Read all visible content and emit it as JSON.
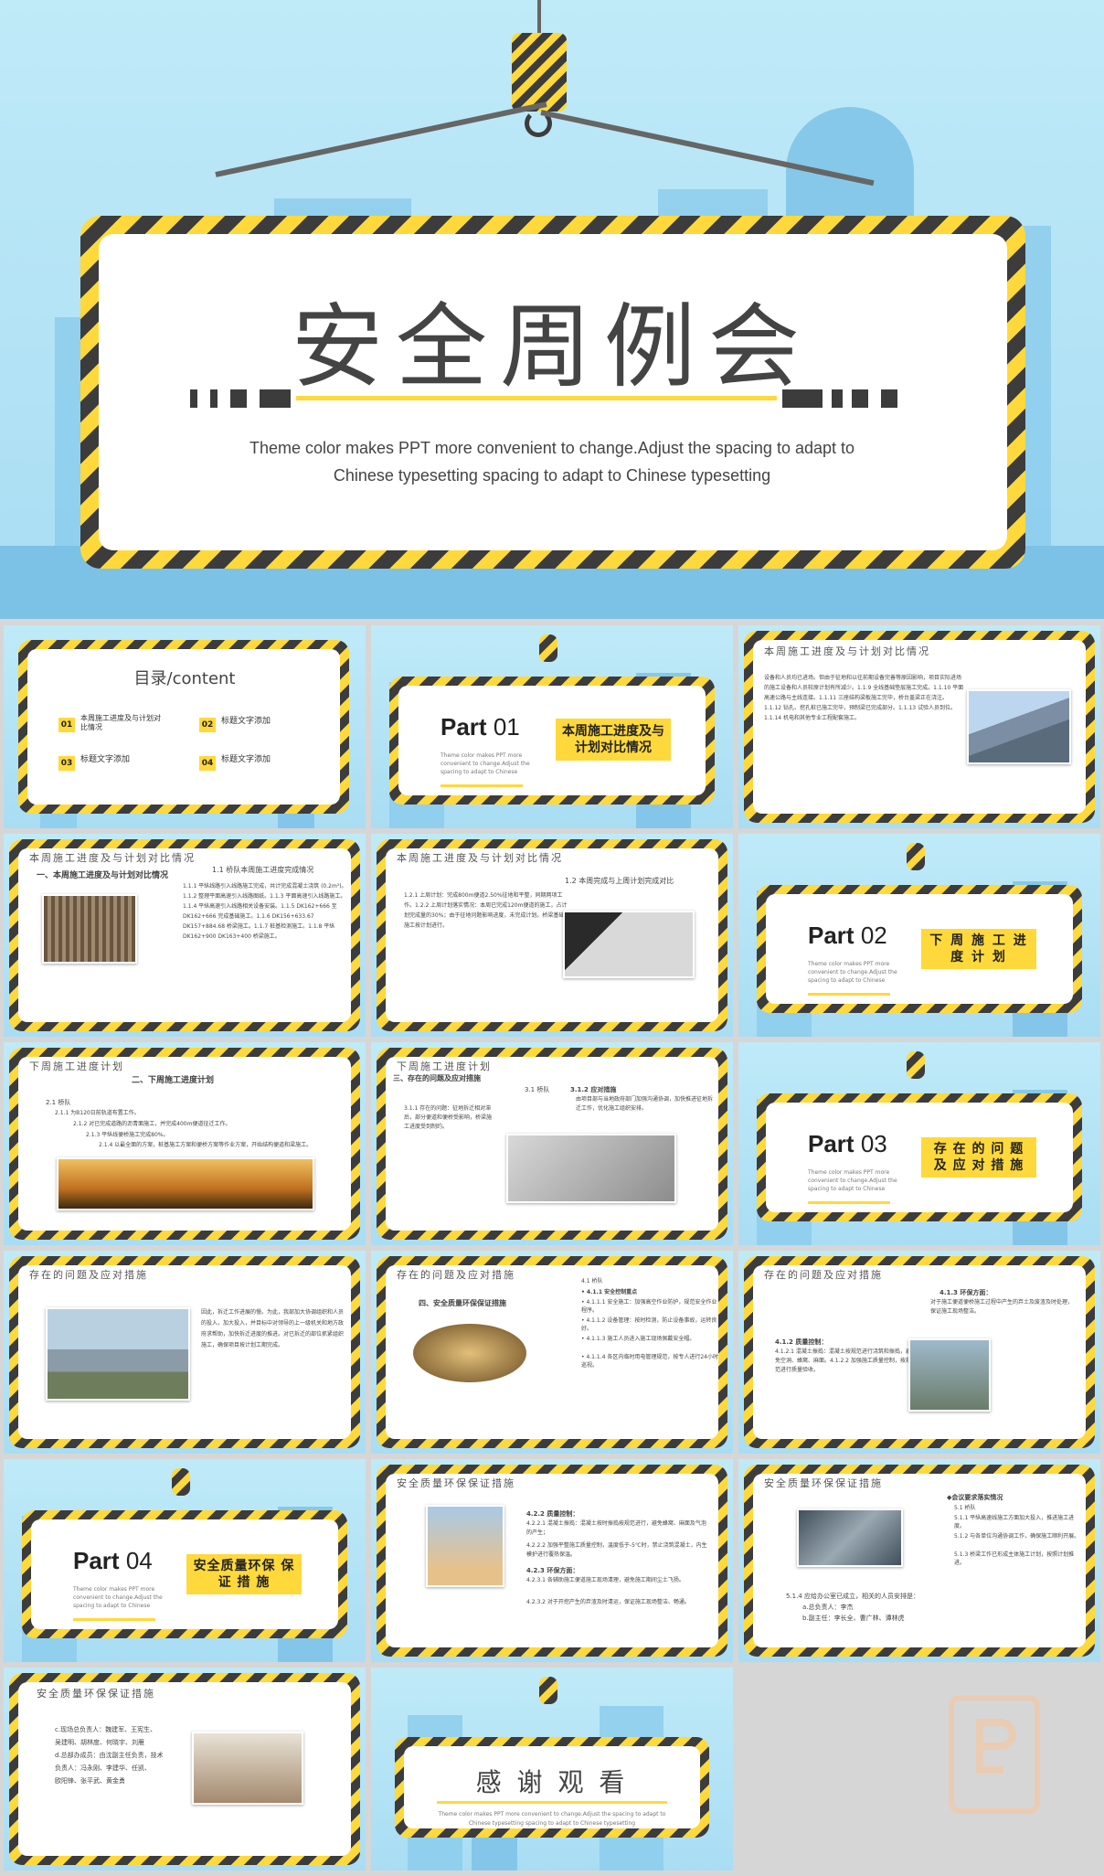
{
  "title_slide": {
    "title": "安全周例会",
    "subtitle_line1": "Theme color makes PPT more convenient to change.Adjust the spacing to adapt to",
    "subtitle_line2": "Chinese typesetting spacing to adapt to Chinese typesetting"
  },
  "toc": {
    "title": "目录/content",
    "items": [
      {
        "num": "01",
        "label": "本周施工进度及与计划对比情况"
      },
      {
        "num": "02",
        "label": "标题文字添加"
      },
      {
        "num": "03",
        "label": "标题文字添加"
      },
      {
        "num": "04",
        "label": "标题文字添加"
      }
    ]
  },
  "part_note": "Theme color makes PPT more convenient to change.Adjust the spacing to adapt to Chinese",
  "parts": [
    {
      "part": "Part",
      "num": "01",
      "title": "本周施工进度及与计划对比情况"
    },
    {
      "part": "Part",
      "num": "02",
      "title": "下 周 施 工 进 度 计 划"
    },
    {
      "part": "Part",
      "num": "03",
      "title": "存 在 的 问 题 及 应 对 措 施"
    },
    {
      "part": "Part",
      "num": "04",
      "title": "安全质量环保 保 证 措 施"
    }
  ],
  "section_titles": {
    "s1": "本周施工进度及与计划对比情况",
    "s2": "下周施工进度计划",
    "s3": "存在的问题及应对措施",
    "s4": "安全质量环保保证措施"
  },
  "slide3": {
    "body": "设备和人员均已进场。但由于征地和以往前期设备完善等原因影响，项目实际进场的施工设备和人员较原计划有所减少。1.1.9 全线基础垫层施工完成。1.1.10 平面高速公路与主线连接。1.1.11 三座结构梁板施工完毕，桥台盖梁正在浇注。1.1.12 钻孔、挖孔桩已施工完毕，预制梁已完成部分。1.1.13 试验人员到位。1.1.14 机电和其他专业工程配套施工。"
  },
  "slide4": {
    "heading": "一、本周施工进度及与计划对比情况",
    "sub": "1.1 桥队本周施工进度完成情况",
    "body": "1.1.1 平纵线路引入线路施工完成，共计完成混凝土浇筑 (0.2m³)。1.1.2 整理平面高速引入线路图纸。1.1.3 平面高速引入线路施工。1.1.4 平纵高速引入线路相关设备安装。1.1.5 DK162+666 至 DK162+666 完成基础施工。1.1.6 DK156+633.67 DK157+884.68 桥梁施工。1.1.7 桩基检测施工。1.1.8 平纵 DK162+900 DK163+400 桥梁施工。"
  },
  "slide5": {
    "sub": "1.2 本周完成与上周计划完成对比",
    "body": "1.2.1 上周计划：完成800m便道2.50%征地和平整，同期两项工作。1.2.2 上周计划落实情况：本周已完成120m便道的施工，占计划完成量的30%；由于征地问题影响进度，未完成计划。桥梁基础施工按计划进行。"
  },
  "slide7": {
    "heading": "二、下周施工进度计划",
    "body_lines": [
      "2.1 桥队",
      "2.1.1 为B120日前轨道布置工作。",
      "2.1.2 对已完成道路的沥青面施工，并完成400m便道征迁工作。",
      "2.1.3 平纵线便桥施工完成80%。",
      "2.1.4 以最全面的方案，桩基施工方案和便桥方案等作业方案，开始结构便道和梁施工。"
    ]
  },
  "slide8": {
    "heading": "三、存在的问题及应对措施",
    "sub_a": "3.1 桥队",
    "sub_b": "3.1.2 应对措施",
    "body_a": "3.1.1 存在的问题：征地拆迁相对滞后，部分便道和便桥受影响，桥梁施工进度受到制约。",
    "body_b": "由项目部与当地政府部门加强沟通协调，加快推进征地拆迁工作，优化施工组织安排。"
  },
  "slide10": {
    "body": "因此，拆迁工作进展的慢。为此，我部加大协调组织和人员的投入，加大投入，并目标中对领导的上一级机关和地方政府求帮助，加快拆迁进度的推进。对已拆迁的部位抓紧组织施工，确保项目按计划工期完成。"
  },
  "slide11": {
    "heading": "四、安全质量环保保证措施",
    "lines": [
      "4.1 桥队",
      "• 4.1.1 安全控制重点",
      "• 4.1.1.1 安全施工：加强高空作业防护，规范安全作业程序。",
      "• 4.1.1.2 设备管理：按时检测，防止设备事故，运转良好。",
      "• 4.1.1.3 施工人员进入施工现场佩戴安全帽。",
      "• 4.1.1.4 各区内临时用电管理规范，按专人进行24小时巡视。"
    ]
  },
  "slide12": {
    "a_title": "4.1.3 环保方面：",
    "a_body": "对于施工便道便桥施工过程中产生的弃土及废渣及时处理，保证施工现场整洁。",
    "b_title": "4.1.2 质量控制：",
    "b_body": "4.1.2.1 混凝土振捣：混凝土按规范进行浇筑和振捣，避免空洞、蜂窝、麻面。4.1.2.2 加强施工质量控制，按规范进行质量验收。"
  },
  "slide14": {
    "lines": [
      "4.2.2 质量控制：",
      "4.2.2.1 混凝土振捣：混凝土按时振捣按规范进行，避免蜂窝、麻面及气泡的产生；",
      "4.2.2.2 加强平整施工质量控制，温度低于-5℃时，禁止浇筑混凝土，内生模护进行覆热保温。",
      "4.2.3 环保方面：",
      "4.2.3.1 各辅助施工便道施工现场清理，避免施工期间尘土飞扬。",
      "4.2.3.2 对于开挖产生的弃渣及时清运，保证施工现场整洁、畅通。"
    ]
  },
  "slide15": {
    "head": "◆会议要求落实情况",
    "lines": [
      "5.1 桥队",
      "5.1.1 平纵高速线施工方面加大投入，推进施工进度。",
      "5.1.2 与各单位沟通协调工作，确保施工顺利开展。",
      "5.1.3 桥梁工作已形成主体施工计划，按照计划推进。"
    ],
    "footer": [
      "5.1.4 应给办公室已成立，相关的人员安排是：",
      "a.总负责人：李杰",
      "b.副主任：李长全、曹广林、谭林虎"
    ]
  },
  "slide16": {
    "lines": [
      "c.现场总负责人：魏建军、王宪生、",
      "吴建明、胡林度、何晓宇、刘雁",
      "d.总部办成员：由沈副主任负责，技术",
      "负责人：冯永刚、李建华、任凯、",
      "欧阳锋、张平武、黄金勇"
    ]
  },
  "end_slide": {
    "title": "感 谢 观 看",
    "note1": "Theme color makes PPT more convenient to change.Adjust the spacing to adapt to",
    "note2": "Chinese typesetting spacing to adapt to Chinese typesetting"
  },
  "colors": {
    "accent": "#ffd93b",
    "dark": "#3c3c3c",
    "sky": "#bfe6f5"
  }
}
